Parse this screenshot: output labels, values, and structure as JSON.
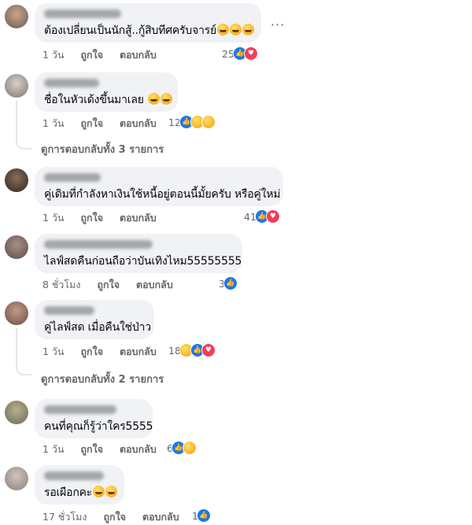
{
  "comments": [
    {
      "text": "ต้องเปลี่ยนเป็นนักสู้..กู้สิบทีศครับจารย์",
      "emoji_count": 3,
      "time": "1 วัน",
      "like": "ถูกใจ",
      "reply": "ตอบกลับ",
      "count": "25",
      "reactions": [
        "like-icon",
        "love-icon"
      ],
      "more": "···"
    },
    {
      "text": "ชื่อในหัวเด้งขึ้นมาเลย",
      "emoji_count": 2,
      "time": "1 วัน",
      "like": "ถูกใจ",
      "reply": "ตอบกลับ",
      "count": "12",
      "reactions": [
        "like-icon",
        "haha-icon",
        "wow-icon"
      ],
      "view_replies": "ดูการตอบกลับทั้ง 3 รายการ"
    },
    {
      "text": "คู่เดิมที่กำลังหาเงินใช้หนี้อยู่ตอนนี้มั้ยครับ หรือคู่ใหม่",
      "emoji_count": 0,
      "time": "1 วัน",
      "like": "ถูกใจ",
      "reply": "ตอบกลับ",
      "count": "41",
      "reactions": [
        "like-icon",
        "love-icon"
      ]
    },
    {
      "text": "ไลฟ์สดคืนก่อนถือว่าบันเทิงไหม55555555",
      "emoji_count": 0,
      "time": "8 ชั่วโมง",
      "like": "ถูกใจ",
      "reply": "ตอบกลับ",
      "count": "3",
      "reactions": [
        "like-icon"
      ]
    },
    {
      "text": "คู่ไลฟ์สด เมื่อคืนใช่ป่าว",
      "emoji_count": 0,
      "time": "1 วัน",
      "like": "ถูกใจ",
      "reply": "ตอบกลับ",
      "count": "18",
      "reactions": [
        "haha-icon",
        "like-icon",
        "love-icon"
      ],
      "view_replies": "ดูการตอบกลับทั้ง 2 รายการ"
    },
    {
      "text": "คนที่คุณก็รู้ว่าใคร5555",
      "emoji_count": 0,
      "time": "1 วัน",
      "like": "ถูกใจ",
      "reply": "ตอบกลับ",
      "count": "6",
      "reactions": [
        "like-icon",
        "care-icon"
      ]
    },
    {
      "text": "รอเผือกคะ",
      "emoji_count": 2,
      "time": "17 ชั่วโมง",
      "like": "ถูกใจ",
      "reply": "ตอบกลับ",
      "count": "1",
      "reactions": [
        "like-icon"
      ]
    }
  ],
  "colors": {
    "bubble": "#f0f2f5",
    "meta": "#65676b",
    "like": "#1877f2",
    "love": "#f33e58"
  }
}
